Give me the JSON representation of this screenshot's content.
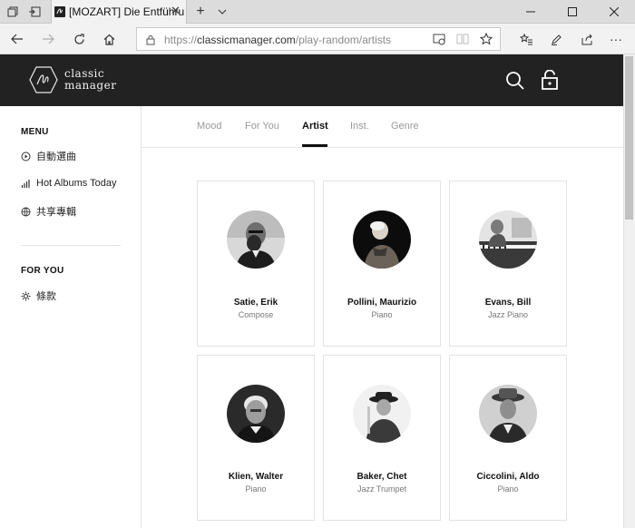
{
  "browser": {
    "tab_title": "[MOZART] Die Entführu",
    "url_prefix": "https://",
    "url_host": "classicmanager.com",
    "url_path": "/play-random/artists"
  },
  "site": {
    "logo_line1": "classic",
    "logo_line2": "manager"
  },
  "sidebar": {
    "menu_heading": "MENU",
    "menu_items": [
      {
        "label": "自動選曲",
        "icon": "clock-play-icon"
      },
      {
        "label": "Hot Albums Today",
        "icon": "chart-bars-icon"
      },
      {
        "label": "共享專輯",
        "icon": "globe-icon"
      }
    ],
    "foryou_heading": "FOR YOU",
    "foryou_items": [
      {
        "label": "條款",
        "icon": "gear-icon"
      }
    ]
  },
  "tabs": [
    "Mood",
    "For You",
    "Artist",
    "Inst.",
    "Genre"
  ],
  "active_tab": "Artist",
  "artists": [
    {
      "name": "Satie, Erik",
      "role": "Compose"
    },
    {
      "name": "Pollini, Maurizio",
      "role": "Piano"
    },
    {
      "name": "Evans, Bill",
      "role": "Jazz Piano"
    },
    {
      "name": "Klien, Walter",
      "role": "Piano"
    },
    {
      "name": "Baker, Chet",
      "role": "Jazz Trumpet"
    },
    {
      "name": "Ciccolini, Aldo",
      "role": "Piano"
    }
  ],
  "colors": {
    "header_bg": "#222222",
    "active_tab": "#111111",
    "inactive_tab": "#9a9a9a"
  }
}
